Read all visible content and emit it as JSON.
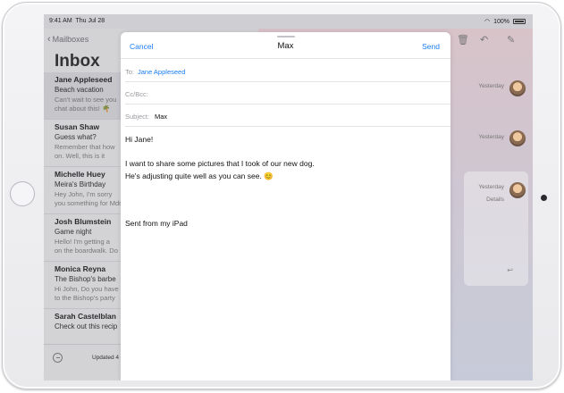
{
  "status": {
    "time": "9:41 AM",
    "date": "Thu Jul 28",
    "battery": "100%"
  },
  "inbox": {
    "back_label": "Mailboxes",
    "title": "Inbox",
    "items": [
      {
        "sender": "Jane Appleseed",
        "subject": "Beach vacation",
        "preview1": "Can't wait to see you",
        "preview2": "chat about this! 🌴"
      },
      {
        "sender": "Susan Shaw",
        "subject": "Guess what?",
        "preview1": "Remember that how",
        "preview2": "on. Well, this is it"
      },
      {
        "sender": "Michelle Huey",
        "subject": "Meira's Birthday",
        "preview1": "Hey John, I'm sorry",
        "preview2": "you something for Mdra"
      },
      {
        "sender": "Josh Blumstein",
        "subject": "Game night",
        "preview1": "Hello! I'm getting a",
        "preview2": "on the boardwalk. Do"
      },
      {
        "sender": "Monica Reyna",
        "subject": "The Bishop's barbe",
        "preview1": "Hi John, Do you have",
        "preview2": "to the Bishop's party"
      },
      {
        "sender": "Sarah Castelblan",
        "subject": "Check out this recip",
        "preview1": "",
        "preview2": ""
      }
    ],
    "footer": "Updated 4 m"
  },
  "detail": {
    "times": [
      "Yesterday",
      "Yesterday",
      "Yesterday"
    ],
    "details_label": "Details"
  },
  "compose": {
    "cancel": "Cancel",
    "title": "Max",
    "send": "Send",
    "to_label": "To:",
    "to_value": "Jane Appleseed",
    "cc_label": "Cc/Bcc:",
    "subject_label": "Subject:",
    "subject_value": "Max",
    "greeting": "Hi Jane!",
    "line1": "I want to share some pictures that I took of our new dog.",
    "line2": "He's adjusting quite well as you can see. 😊",
    "signature": "Sent from my iPad"
  },
  "colors": {
    "accent": "#1a7cf5"
  }
}
